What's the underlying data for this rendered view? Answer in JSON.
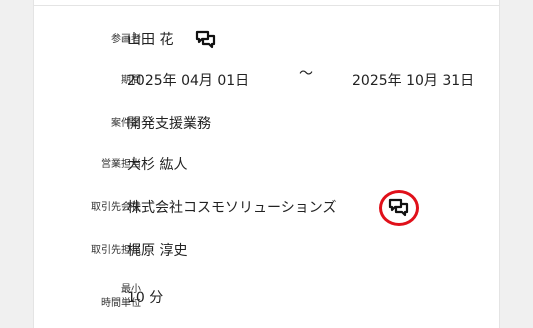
{
  "fields": {
    "participant": {
      "label": "参画者",
      "value": "山田 花"
    },
    "period": {
      "label": "期間",
      "start": "2025年 04月 01日",
      "separator": "～",
      "end": "2025年 10月 31日"
    },
    "project_name": {
      "label": "案件名",
      "value": "開発支援業務"
    },
    "sales_rep": {
      "label": "営業担当",
      "value": "大杉 紘人"
    },
    "client_company": {
      "label": "取引先会社",
      "value": "株式会社コスモソリューションズ"
    },
    "client_rep": {
      "label": "取引先担当",
      "value": "梶原 淳史"
    },
    "min_time_unit": {
      "label_line1": "最小",
      "label_line2": "時間単位",
      "value": "10 分"
    }
  },
  "icons": {
    "participant_chat": "chat-bubbles-icon",
    "client_chat": "chat-bubbles-icon"
  },
  "colors": {
    "highlight_ring": "#e0101a"
  }
}
